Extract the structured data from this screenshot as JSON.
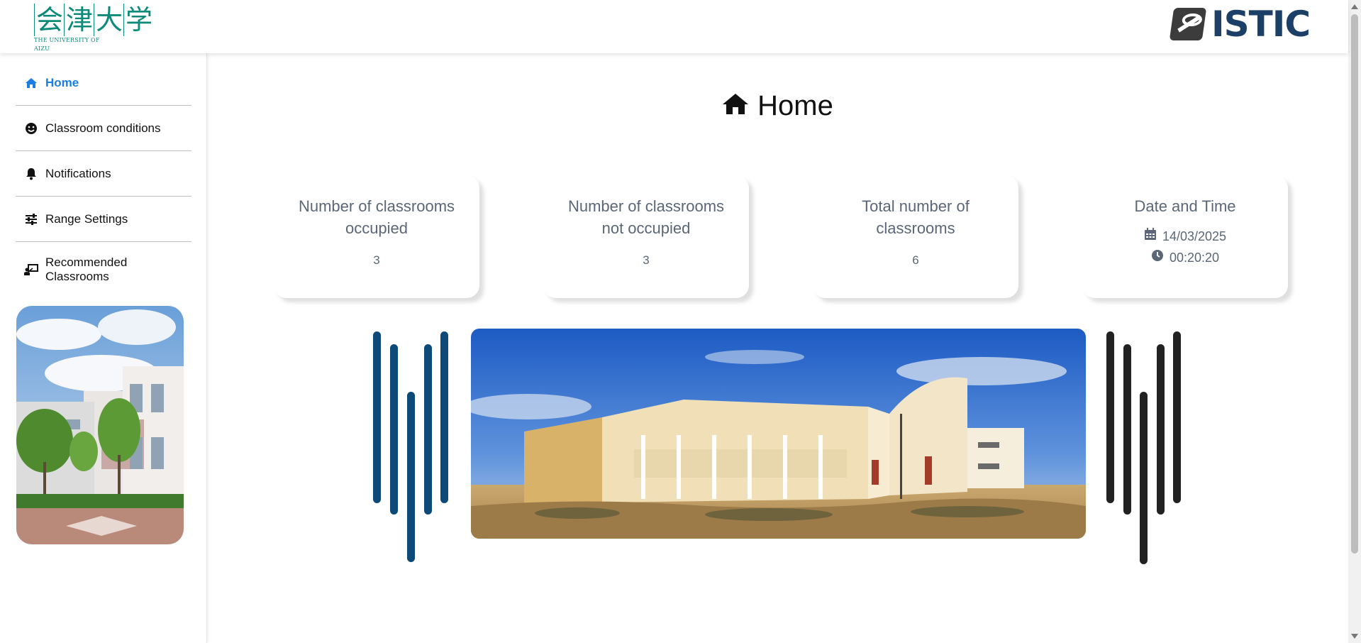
{
  "header": {
    "left_logo": {
      "kanji": [
        "会",
        "津",
        "大",
        "学"
      ],
      "subtitle": "THE UNIVERSITY OF AIZU"
    },
    "right_logo": {
      "word": "ISTIC",
      "color": "#1b3f66"
    }
  },
  "sidebar": {
    "items": [
      {
        "label": "Home",
        "icon": "home-icon",
        "active": true
      },
      {
        "label": "Classroom conditions",
        "icon": "smile-icon"
      },
      {
        "label": "Notifications",
        "icon": "bell-icon"
      },
      {
        "label": "Range Settings",
        "icon": "sliders-icon"
      },
      {
        "label": "Recommended Classrooms",
        "icon": "teacher-board-icon"
      }
    ]
  },
  "main": {
    "title": "Home",
    "cards": [
      {
        "title": "Number of classrooms occupied",
        "value": "3"
      },
      {
        "title": "Number of classrooms not occupied",
        "value": "3"
      },
      {
        "title": "Total number of classrooms",
        "value": "6"
      },
      {
        "title": "Date and Time",
        "date": "14/03/2025",
        "time": "00:20:20"
      }
    ]
  },
  "colors": {
    "accent": "#1a7ee6",
    "bars_left": "#0e4a78",
    "bars_right": "#222222",
    "card_text": "#5b6776"
  }
}
